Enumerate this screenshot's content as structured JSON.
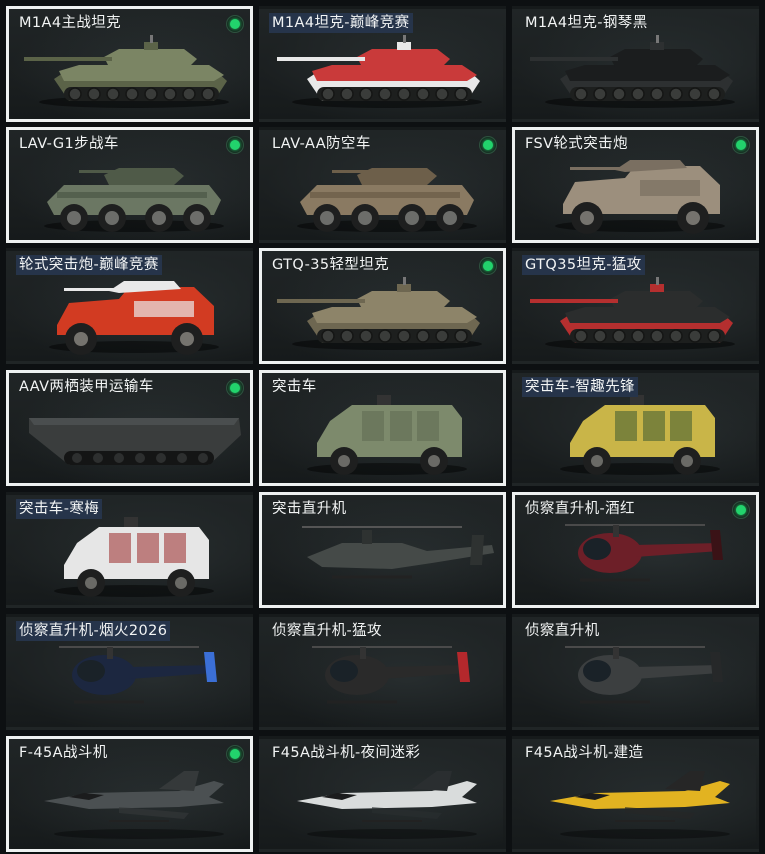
{
  "vehicles": [
    {
      "name": "M1A4主战坦克",
      "unlocked": true,
      "selected": true,
      "title_highlight": false,
      "icon": "tank-icon",
      "colors": [
        "#7b8564",
        "#5b6348"
      ]
    },
    {
      "name": "M1A4坦克-巅峰竞赛",
      "unlocked": false,
      "selected": false,
      "title_highlight": true,
      "icon": "tank-icon",
      "colors": [
        "#c93a3a",
        "#e8e8e8"
      ]
    },
    {
      "name": "M1A4坦克-钢琴黑",
      "unlocked": false,
      "selected": false,
      "title_highlight": false,
      "icon": "tank-icon",
      "colors": [
        "#1b1d1e",
        "#2d3031"
      ]
    },
    {
      "name": "LAV-G1步战车",
      "unlocked": true,
      "selected": true,
      "title_highlight": false,
      "icon": "ifv-icon",
      "colors": [
        "#6b7763",
        "#4f5a48"
      ]
    },
    {
      "name": "LAV-AA防空车",
      "unlocked": true,
      "selected": false,
      "title_highlight": false,
      "icon": "aa-vehicle-icon",
      "colors": [
        "#8a7a62",
        "#6d5f4a"
      ]
    },
    {
      "name": "FSV轮式突击炮",
      "unlocked": true,
      "selected": true,
      "title_highlight": false,
      "icon": "wheeled-gun-icon",
      "colors": [
        "#9c8f7d",
        "#7a6f61"
      ]
    },
    {
      "name": "轮式突击炮-巅峰竞赛",
      "unlocked": false,
      "selected": false,
      "title_highlight": true,
      "icon": "wheeled-gun-icon",
      "colors": [
        "#d23b22",
        "#e9e9e9"
      ]
    },
    {
      "name": "GTQ-35轻型坦克",
      "unlocked": true,
      "selected": true,
      "title_highlight": false,
      "icon": "light-tank-icon",
      "colors": [
        "#8d8469",
        "#6e6751"
      ]
    },
    {
      "name": "GTQ35坦克-猛攻",
      "unlocked": false,
      "selected": false,
      "title_highlight": true,
      "icon": "light-tank-icon",
      "colors": [
        "#2b2d2d",
        "#b52f2f"
      ]
    },
    {
      "name": "AAV两栖装甲运输车",
      "unlocked": true,
      "selected": true,
      "title_highlight": false,
      "icon": "amphibious-icon",
      "colors": [
        "#3a3d3d",
        "#2a2c2c"
      ]
    },
    {
      "name": "突击车",
      "unlocked": false,
      "selected": true,
      "title_highlight": false,
      "icon": "assault-vehicle-icon",
      "colors": [
        "#7d8a6c",
        "#5f6a52"
      ]
    },
    {
      "name": "突击车-智趣先锋",
      "unlocked": false,
      "selected": false,
      "title_highlight": true,
      "icon": "assault-vehicle-icon",
      "colors": [
        "#c9b548",
        "#3c5a32"
      ]
    },
    {
      "name": "突击车-寒梅",
      "unlocked": false,
      "selected": false,
      "title_highlight": true,
      "icon": "assault-vehicle-icon",
      "colors": [
        "#e6e6e6",
        "#9b2a2a"
      ]
    },
    {
      "name": "突击直升机",
      "unlocked": false,
      "selected": true,
      "title_highlight": false,
      "icon": "attack-helicopter-icon",
      "colors": [
        "#454a48",
        "#2e3231"
      ]
    },
    {
      "name": "侦察直升机-酒红",
      "unlocked": true,
      "selected": true,
      "title_highlight": false,
      "icon": "scout-helicopter-icon",
      "colors": [
        "#6d1f28",
        "#3a1216"
      ]
    },
    {
      "name": "侦察直升机-烟火2026",
      "unlocked": false,
      "selected": false,
      "title_highlight": true,
      "icon": "scout-helicopter-icon",
      "colors": [
        "#1c2740",
        "#3b6fd6"
      ]
    },
    {
      "name": "侦察直升机-猛攻",
      "unlocked": false,
      "selected": false,
      "title_highlight": false,
      "icon": "scout-helicopter-icon",
      "colors": [
        "#2a2a2a",
        "#b4282c"
      ]
    },
    {
      "name": "侦察直升机",
      "unlocked": false,
      "selected": false,
      "title_highlight": false,
      "icon": "scout-helicopter-icon",
      "colors": [
        "#3c3f40",
        "#262829"
      ]
    },
    {
      "name": "F-45A战斗机",
      "unlocked": true,
      "selected": true,
      "title_highlight": false,
      "icon": "fighter-jet-icon",
      "colors": [
        "#4b5052",
        "#35393a"
      ]
    },
    {
      "name": "F45A战斗机-夜间迷彩",
      "unlocked": false,
      "selected": false,
      "title_highlight": false,
      "icon": "fighter-jet-icon",
      "colors": [
        "#d9dcdc",
        "#2a2e30"
      ]
    },
    {
      "name": "F45A战斗机-建造",
      "unlocked": false,
      "selected": false,
      "title_highlight": false,
      "icon": "fighter-jet-icon",
      "colors": [
        "#e2b321",
        "#262626"
      ]
    }
  ],
  "theme": {
    "selected_border": "#eef1f1",
    "unlocked_dot": "#22d36c",
    "title_highlight_bg": "#26344a"
  }
}
